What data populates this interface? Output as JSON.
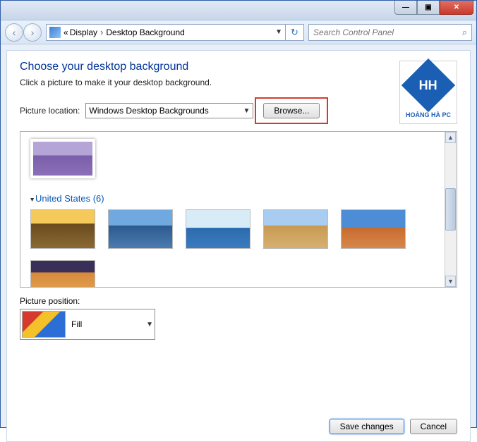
{
  "titlebar": {
    "min": "—",
    "max": "▣",
    "close": "✕"
  },
  "toolbar": {
    "back": "‹",
    "forward": "›",
    "breadcrumb_overflow": "«",
    "crumb1": "Display",
    "crumb2": "Desktop Background",
    "refresh": "↻",
    "search_placeholder": "Search Control Panel",
    "search_icon": "⌕"
  },
  "main": {
    "heading": "Choose your desktop background",
    "subtext": "Click a picture to make it your desktop background.",
    "picture_location_label": "Picture location:",
    "picture_location_value": "Windows Desktop Backgrounds",
    "browse_label": "Browse...",
    "category": "United States (6)",
    "position_label": "Picture position:",
    "position_value": "Fill"
  },
  "logo": {
    "mark": "HH",
    "text": "HOÀNG HÀ PC"
  },
  "footer": {
    "save": "Save changes",
    "cancel": "Cancel"
  }
}
